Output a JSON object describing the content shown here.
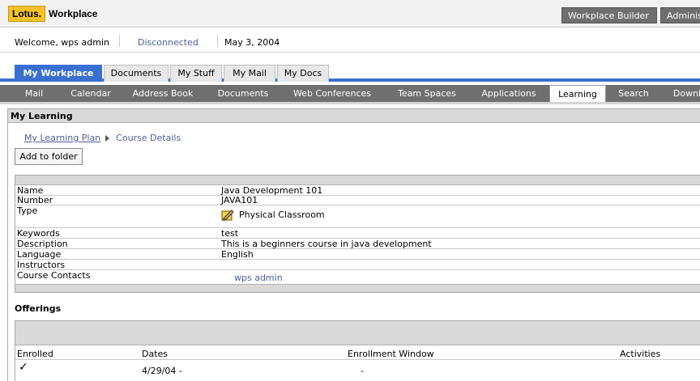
{
  "header": {
    "logo_brand": "Lotus.",
    "logo_product": "Workplace",
    "buttons": [
      "Workplace Builder",
      "Adminis"
    ]
  },
  "welcome": {
    "greeting": "Welcome, wps admin",
    "status": "Disconnected",
    "date": "May 3, 2004"
  },
  "main_tabs": [
    {
      "label": "My Workplace",
      "active": true
    },
    {
      "label": "Documents",
      "active": false
    },
    {
      "label": "My Stuff",
      "active": false
    },
    {
      "label": "My Mail",
      "active": false
    },
    {
      "label": "My Docs",
      "active": false
    }
  ],
  "sub_tabs": [
    {
      "label": "Mail",
      "active": false
    },
    {
      "label": "Calendar",
      "active": false
    },
    {
      "label": "Address Book",
      "active": false
    },
    {
      "label": "Documents",
      "active": false
    },
    {
      "label": "Web Conferences",
      "active": false
    },
    {
      "label": "Team Spaces",
      "active": false
    },
    {
      "label": "Applications",
      "active": false
    },
    {
      "label": "Learning",
      "active": true
    },
    {
      "label": "Search",
      "active": false
    },
    {
      "label": "Downl",
      "active": false
    }
  ],
  "portlet": {
    "title": "My Learning",
    "breadcrumb": {
      "parent": "My Learning Plan",
      "current": "Course Details"
    },
    "add_folder_label": "Add to folder"
  },
  "course": {
    "rows": [
      {
        "label": "Name",
        "value": "Java Development 101"
      },
      {
        "label": "Number",
        "value": "JAVA101"
      },
      {
        "label": "Type",
        "value": "Physical Classroom"
      },
      {
        "label": "Keywords",
        "value": "test"
      },
      {
        "label": "Description",
        "value": "This is a beginners course in java development"
      },
      {
        "label": "Language",
        "value": "English"
      },
      {
        "label": "Instructors",
        "value": ""
      },
      {
        "label": "Course Contacts",
        "value": "wps admin"
      }
    ]
  },
  "offerings": {
    "title": "Offerings",
    "columns": [
      "Enrolled",
      "Dates",
      "Enrollment Window",
      "Activities"
    ],
    "rows": [
      {
        "enrolled": "✓",
        "dates": "4/29/04  -",
        "window": "-",
        "activities": ""
      }
    ]
  }
}
